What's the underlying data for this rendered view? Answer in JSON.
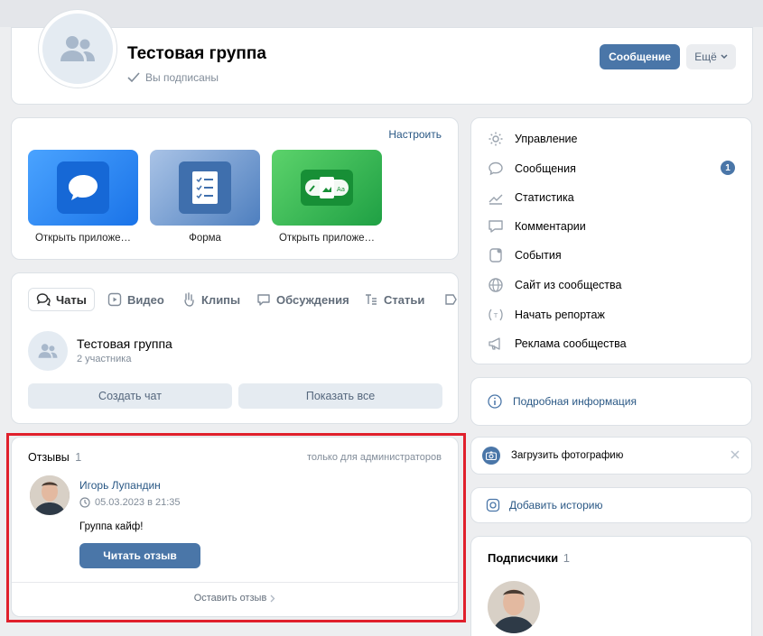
{
  "header": {
    "title": "Тестовая группа",
    "subscribed": "Вы подписаны",
    "message_button": "Сообщение",
    "more_button": "Ещё"
  },
  "apps": {
    "configure_link": "Настроить",
    "items": [
      {
        "label": "Открыть приложе…",
        "icon": "message-bubble-icon",
        "color": "#2787f5"
      },
      {
        "label": "Форма",
        "icon": "form-checklist-icon",
        "color": "#5181b8"
      },
      {
        "label": "Открыть приложе…",
        "icon": "image-text-app-icon",
        "color": "#4bb34b"
      }
    ]
  },
  "tabs": {
    "items": [
      {
        "label": "Чаты",
        "icon": "chats-icon"
      },
      {
        "label": "Видео",
        "icon": "video-icon"
      },
      {
        "label": "Клипы",
        "icon": "clips-icon"
      },
      {
        "label": "Обсуждения",
        "icon": "discussions-icon"
      },
      {
        "label": "Статьи",
        "icon": "articles-icon"
      }
    ],
    "chat": {
      "title": "Тестовая группа",
      "members": "2 участника"
    },
    "create_chat": "Создать чат",
    "show_all": "Показать все"
  },
  "reviews": {
    "title": "Отзывы",
    "count": "1",
    "visibility": "только для администраторов",
    "author": "Игорь Лупандин",
    "date": "05.03.2023 в 21:35",
    "text": "Группа кайф!",
    "read_button": "Читать отзыв",
    "leave_review": "Оставить отзыв"
  },
  "menu": {
    "items": [
      {
        "label": "Управление",
        "icon": "gear-icon"
      },
      {
        "label": "Сообщения",
        "icon": "message-icon",
        "badge": "1"
      },
      {
        "label": "Статистика",
        "icon": "stats-icon"
      },
      {
        "label": "Комментарии",
        "icon": "comment-icon"
      },
      {
        "label": "События",
        "icon": "events-icon"
      },
      {
        "label": "Сайт из сообщества",
        "icon": "globe-icon"
      },
      {
        "label": "Начать репортаж",
        "icon": "broadcast-icon"
      },
      {
        "label": "Реклама сообщества",
        "icon": "megaphone-icon"
      }
    ]
  },
  "info": {
    "label": "Подробная информация"
  },
  "upload": {
    "label": "Загрузить фотографию"
  },
  "story": {
    "label": "Добавить историю"
  },
  "subscribers": {
    "title": "Подписчики",
    "count": "1"
  },
  "colors": {
    "accent": "#4a76a8",
    "frame": "#e0202c",
    "background": "#edeef0"
  }
}
